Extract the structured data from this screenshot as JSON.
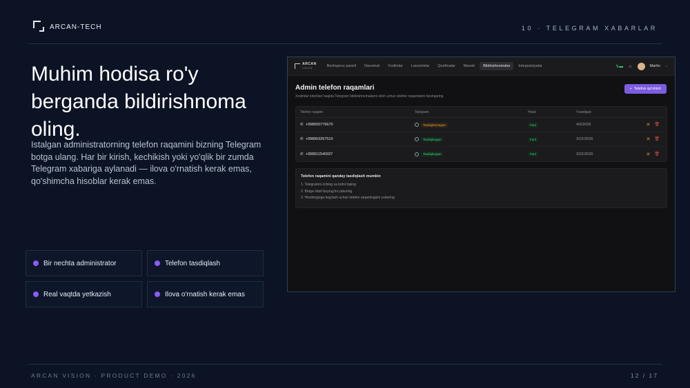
{
  "brand": {
    "name": "ARCAN-TECH"
  },
  "section_label": "10 · TELEGRAM XABARLAR",
  "headline": "Muhim hodisa ro'y berganda bildirishnoma oling.",
  "description": "Istalgan administratorning telefon raqamini bizning Telegram botga ulang. Har bir kirish, kechikish yoki yo'qlik bir zumda Telegram xabariga aylanadi — ilova o'rnatish kerak emas, qo'shimcha hisoblar kerak emas.",
  "features": [
    {
      "label": "Bir nechta administrator"
    },
    {
      "label": "Telefon tasdiqlash"
    },
    {
      "label": "Real vaqtda yetkazish"
    },
    {
      "label": "Ilova o'rnatish kerak emas"
    }
  ],
  "footer": {
    "left": "ARCAN VISION · PRODUCT DEMO · 2026",
    "right": "12 / 17"
  },
  "colors": {
    "accent": "#8b5cf6",
    "background": "#0c1324"
  },
  "app": {
    "logo_top": "ARCAN",
    "logo_bottom": "VISION",
    "nav": [
      {
        "label": "Boshqaruv paneli"
      },
      {
        "label": "Davomat"
      },
      {
        "label": "Xodimlar"
      },
      {
        "label": "Lavozimlar"
      },
      {
        "label": "Qurilmalar"
      },
      {
        "label": "Maosh"
      },
      {
        "label": "Bildirishnomalar",
        "active": true
      },
      {
        "label": "Integratsiyalar"
      }
    ],
    "user": "Martin",
    "page_title": "Admin telefon raqamlari",
    "page_subtitle": "Xodimlar kirishlari haqida Telegram bildirishnomalarini olish uchun telefon raqamlarini boshqaring",
    "add_button": "Telefon qo'shish",
    "table": {
      "headers": [
        "Telefon raqami",
        "Telegram",
        "Holat",
        "Yaratilgan"
      ],
      "rows": [
        {
          "phone": "+998500779670",
          "telegram": "Tasdiqlanmagan",
          "telegram_status": "warn",
          "status": "Faol",
          "created": "4/2/2026"
        },
        {
          "phone": "+998903357510",
          "telegram": "Tasdiqlangan",
          "telegram_status": "ok",
          "status": "Faol",
          "created": "3/22/2026"
        },
        {
          "phone": "+998911540937",
          "telegram": "Tasdiqlangan",
          "telegram_status": "ok",
          "status": "Faol",
          "created": "3/22/2026"
        }
      ]
    },
    "info": {
      "title": "Telefon raqamini qanday tasdiqlash mumkin",
      "steps": [
        "1. Telegramni oching va botni toping",
        "2. Botga /start buyrug'ini yuboring",
        "3. Hisobingizga bog'lash uchun telefon raqamingizni yuboring"
      ]
    }
  }
}
